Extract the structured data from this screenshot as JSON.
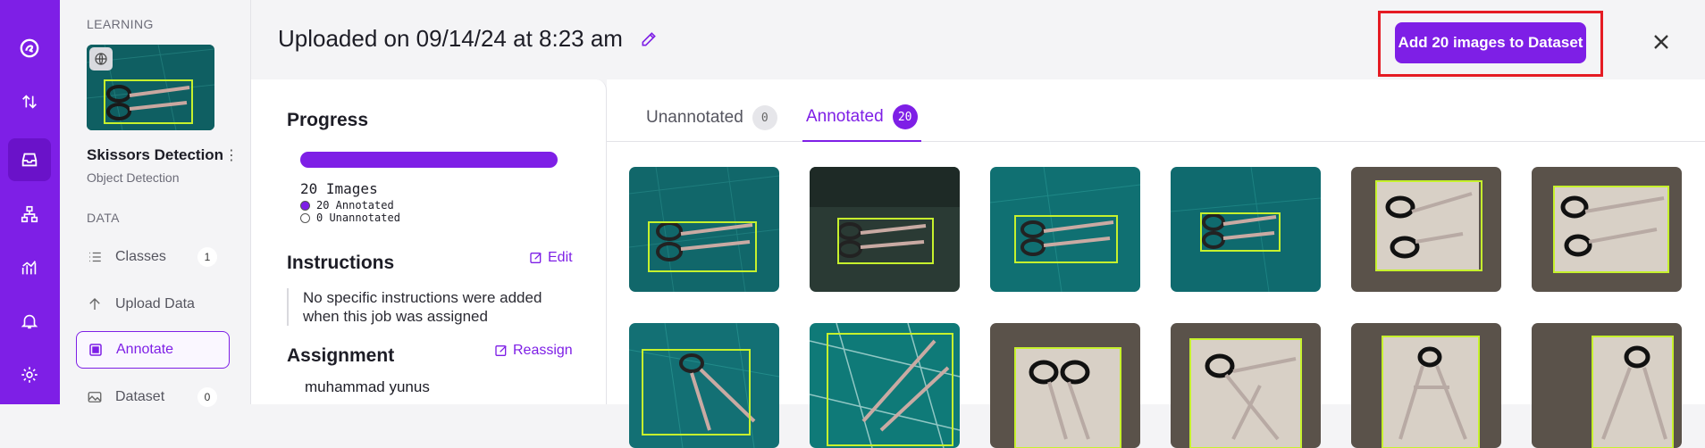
{
  "rail": {
    "icons": [
      "logo-icon",
      "sort-arrows-icon",
      "inbox-icon",
      "workflow-icon",
      "analytics-icon",
      "bell-icon",
      "settings-icon"
    ]
  },
  "sidebar": {
    "section_learning": "LEARNING",
    "project_name": "Skissors Detection",
    "project_type": "Object Detection",
    "section_data": "DATA",
    "items": [
      {
        "label": "Classes",
        "badge": "1"
      },
      {
        "label": "Upload Data",
        "badge": ""
      },
      {
        "label": "Annotate",
        "badge": ""
      },
      {
        "label": "Dataset",
        "badge": "0"
      }
    ]
  },
  "header": {
    "title": "Uploaded on 09/14/24 at 8:23 am",
    "add_button": "Add 20 images to Dataset"
  },
  "panel": {
    "progress_title": "Progress",
    "progress_fraction": 1.0,
    "images_label": "20 Images",
    "annotated_label": "20 Annotated",
    "unannotated_label": "0 Unannotated",
    "instructions_title": "Instructions",
    "edit_label": "Edit",
    "instructions_text": "No specific instructions were added when this job was assigned",
    "assignment_title": "Assignment",
    "reassign_label": "Reassign",
    "assignee": "muhammad yunus"
  },
  "tabs": [
    {
      "label": "Unannotated",
      "count": "0"
    },
    {
      "label": "Annotated",
      "count": "20"
    }
  ],
  "colors": {
    "accent": "#7e1fe6",
    "highlight": "#e51b23",
    "bbox": "#c6f12d"
  }
}
